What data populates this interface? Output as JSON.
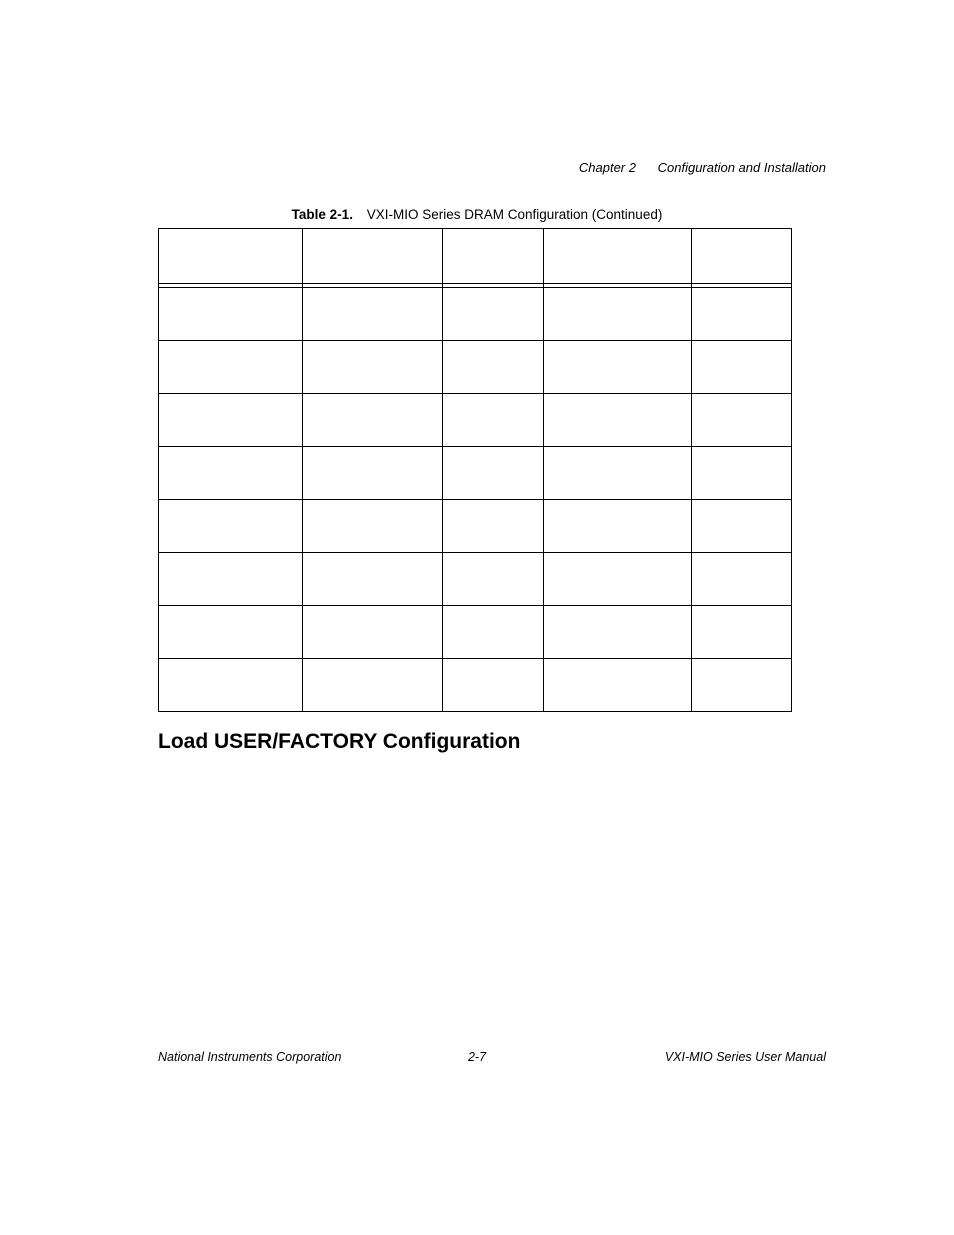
{
  "running_head": {
    "chapter": "Chapter 2",
    "title": "Configuration and Installation"
  },
  "table": {
    "caption_label": "Table 2-1.",
    "caption_text": "VXI-MIO Series DRAM Configuration (Continued)",
    "headers": [
      "",
      "",
      "",
      "",
      ""
    ],
    "rows": [
      [
        "",
        "",
        "",
        "",
        ""
      ],
      [
        "",
        "",
        "",
        "",
        ""
      ],
      [
        "",
        "",
        "",
        "",
        ""
      ],
      [
        "",
        "",
        "",
        "",
        ""
      ],
      [
        "",
        "",
        "",
        "",
        ""
      ],
      [
        "",
        "",
        "",
        "",
        ""
      ],
      [
        "",
        "",
        "",
        "",
        ""
      ],
      [
        "",
        "",
        "",
        "",
        ""
      ]
    ]
  },
  "section_heading": "Load USER/FACTORY Configuration",
  "footer": {
    "left": "National Instruments Corporation",
    "center": "2-7",
    "right": "VXI-MIO Series User Manual"
  }
}
